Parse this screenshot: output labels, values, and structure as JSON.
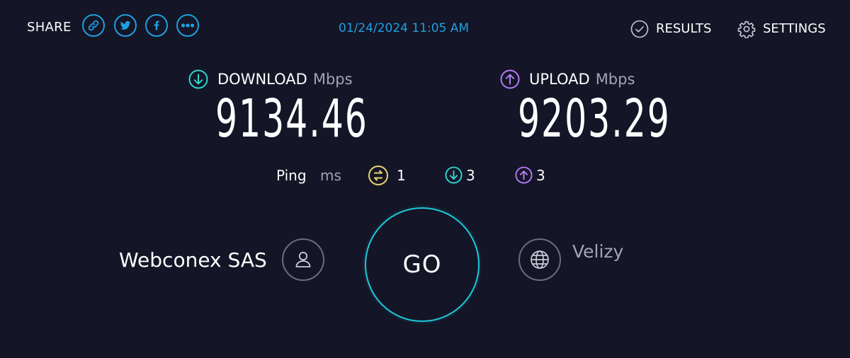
{
  "share": {
    "label": "SHARE",
    "buttons": [
      "link-icon",
      "twitter-icon",
      "facebook-icon",
      "more-icon"
    ]
  },
  "timestamp": "01/24/2024 11:05 AM",
  "nav": {
    "results_label": "RESULTS",
    "settings_label": "SETTINGS"
  },
  "download": {
    "label": "DOWNLOAD",
    "unit": "Mbps",
    "value": "9134.46",
    "icon": "arrow-down-circle-icon",
    "color": "#2fd6cf"
  },
  "upload": {
    "label": "UPLOAD",
    "unit": "Mbps",
    "value": "9203.29",
    "icon": "arrow-up-circle-icon",
    "color": "#b37cf5"
  },
  "ping": {
    "label": "Ping",
    "unit": "ms",
    "idle": {
      "value": "1",
      "icon": "idle-latency-icon",
      "color": "#e8d66a"
    },
    "download": {
      "value": "3",
      "icon": "download-latency-icon",
      "color": "#2fd6cf"
    },
    "upload": {
      "value": "3",
      "icon": "upload-latency-icon",
      "color": "#b37cf5"
    }
  },
  "provider": {
    "name": "Webconex SAS",
    "icon": "user-icon"
  },
  "go_label": "GO",
  "server": {
    "location": "Velizy",
    "icon": "globe-icon"
  },
  "colors": {
    "background": "#141526",
    "accent": "#1ea0e0",
    "go_ring": "#1ec8d9"
  }
}
